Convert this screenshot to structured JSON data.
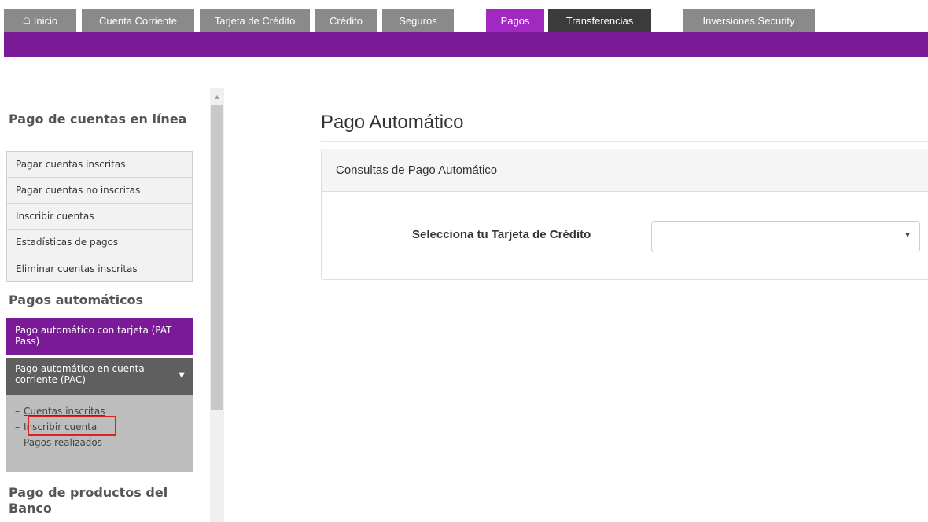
{
  "nav": {
    "tabs": [
      {
        "label": "Inicio",
        "icon": "home-icon"
      },
      {
        "label": "Cuenta Corriente"
      },
      {
        "label": "Tarjeta de Crédito"
      },
      {
        "label": "Crédito"
      },
      {
        "label": "Seguros"
      },
      {
        "label": "Pagos",
        "active": true
      },
      {
        "label": "Transferencias"
      },
      {
        "label": "Inversiones Security"
      }
    ],
    "accent_color": "#7b1a96"
  },
  "sidebar": {
    "section1_title": "Pago de cuentas en línea",
    "section1_items": [
      {
        "label": "Pagar cuentas inscritas"
      },
      {
        "label": "Pagar cuentas no inscritas"
      },
      {
        "label": "Inscribir cuentas"
      },
      {
        "label": "Estadísticas de pagos"
      },
      {
        "label": "Eliminar cuentas inscritas"
      }
    ],
    "section2_title": "Pagos automáticos",
    "pat_pass_label": "Pago automático con tarjeta (PAT Pass)",
    "pac_label": "Pago automático en cuenta corriente (PAC)",
    "pac_sub_items": [
      {
        "label": "Cuentas inscritas"
      },
      {
        "label": "Inscribir cuenta"
      },
      {
        "label": "Pagos realizados"
      }
    ],
    "sub_prefix": "–",
    "section3_title": "Pago de productos del Banco"
  },
  "main": {
    "title": "Pago Automático",
    "panel_title": "Consultas de Pago Automático",
    "select_label": "Selecciona tu Tarjeta de Crédito",
    "select_value": ""
  }
}
